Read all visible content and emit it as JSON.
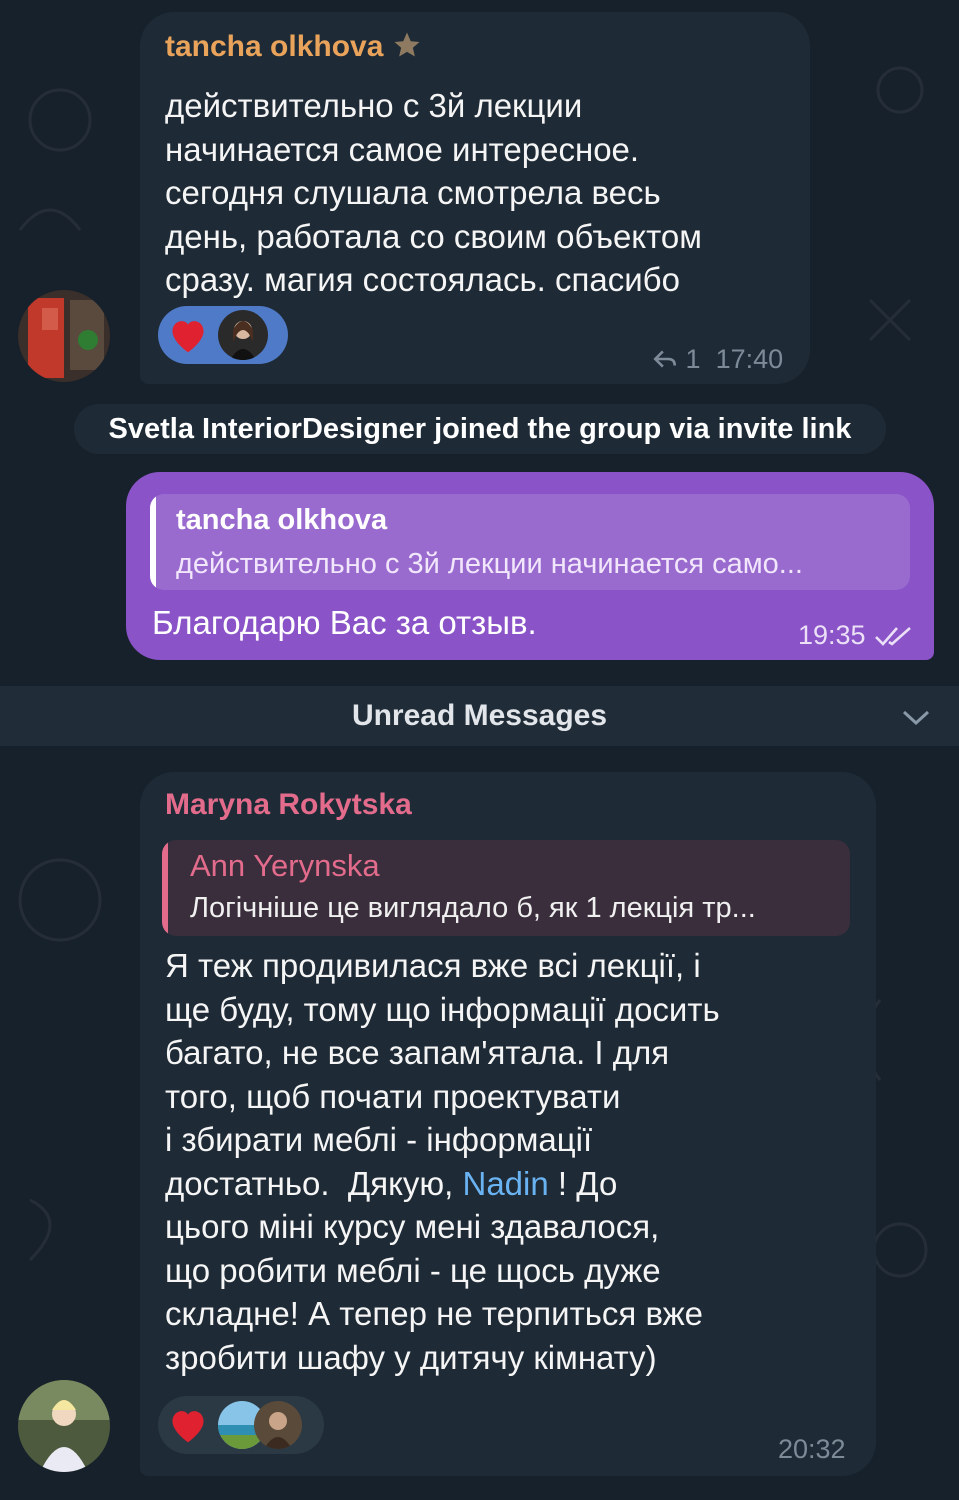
{
  "messages": [
    {
      "sender": "tancha olkhova",
      "sender_color": "#e9a35b",
      "text_lines": [
        "действительно с 3й лекции",
        "начинается самое интересное.",
        "сегодня слушала смотрела весь",
        "день, работала со своим объектом",
        "сразу. магия состоялась. спасибо"
      ],
      "reply_count": "1",
      "time": "17:40"
    },
    {
      "reply_to": {
        "sender": "tancha olkhova",
        "text": "действительно с 3й лекции начинается само..."
      },
      "text": "Благодарю Вас за отзыв.",
      "time": "19:35"
    },
    {
      "sender": "Maryna Rokytska",
      "sender_color": "#e36b8c",
      "reply_to": {
        "sender": "Ann Yerynska",
        "text": "Логічніше це виглядало б, як 1 лекція тр..."
      },
      "text_lines": [
        "Я теж продивилася вже всі лекції, і",
        "ще буду, тому що інформації досить",
        "багато, не все запам'ятала. І для",
        "того, щоб почати проектувати",
        "і збирати меблі - інформації"
      ],
      "line6_before": "достатньо.  Дякую, ",
      "mention": "Nadin",
      "line6_after": " ! До",
      "text_lines_end": [
        "цього міні курсу мені здавалося,",
        "що робити меблі - це щось дуже",
        "складне! А тепер не терпиться вже",
        "зробити шафу у дитячу кімнату)"
      ],
      "time": "20:32"
    }
  ],
  "service_message": "Svetla InteriorDesigner joined the group via invite link",
  "unread_label": "Unread Messages",
  "colors": {
    "background": "#17212b",
    "incoming_bubble": "#1e2a35",
    "outgoing_bubble": "#8a53c8",
    "mention": "#6ab3f3"
  }
}
